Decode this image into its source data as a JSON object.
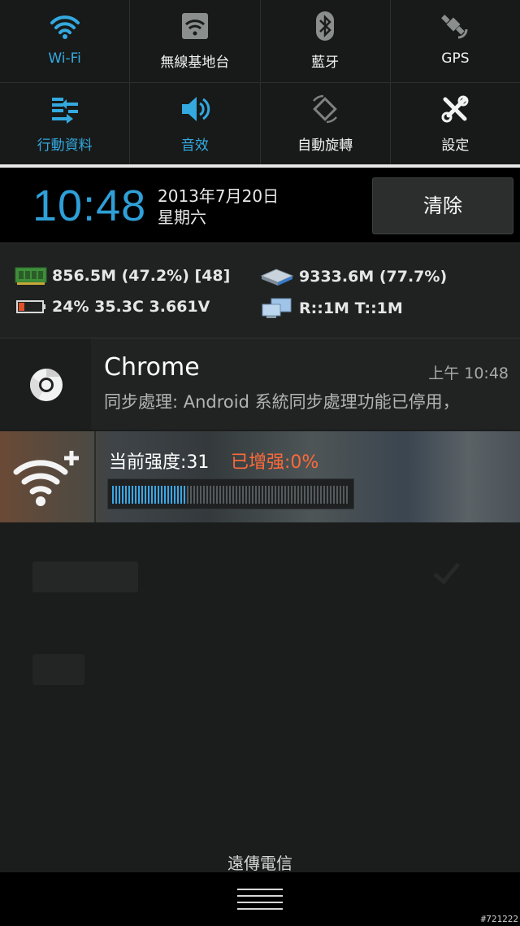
{
  "quick_settings": {
    "row1": [
      {
        "label": "Wi-Fi",
        "icon": "wifi-icon",
        "active": true
      },
      {
        "label": "無線基地台",
        "icon": "hotspot-icon",
        "active": false
      },
      {
        "label": "藍牙",
        "icon": "bluetooth-icon",
        "active": false
      },
      {
        "label": "GPS",
        "icon": "gps-icon",
        "active": false
      }
    ],
    "row2": [
      {
        "label": "行動資料",
        "icon": "mobile-data-icon",
        "active": true
      },
      {
        "label": "音效",
        "icon": "sound-icon",
        "active": true
      },
      {
        "label": "自動旋轉",
        "icon": "auto-rotate-icon",
        "active": false
      },
      {
        "label": "設定",
        "icon": "settings-icon",
        "active": false
      }
    ]
  },
  "header": {
    "time": "10:48",
    "date": "2013年7月20日",
    "weekday": "星期六",
    "clear_label": "清除"
  },
  "stats": {
    "memory": "856.5M (47.2%) [48]",
    "storage": "9333.6M (77.7%)",
    "battery": "24% 35.3C 3.661V",
    "network": "R::1M T::1M"
  },
  "notifications": {
    "chrome": {
      "title": "Chrome",
      "time": "上午 10:48",
      "text": "同步處理: Android 系統同步處理功能已停用，"
    },
    "wifi_boost": {
      "strength_label": "当前强度:31",
      "boost_label": "已增强:0%",
      "strength_fraction": 0.31
    }
  },
  "footer": {
    "carrier": "遠傳電信"
  },
  "watermark": "#721222",
  "colors": {
    "accent": "#34a9e0",
    "boost": "#ff6a3a"
  }
}
